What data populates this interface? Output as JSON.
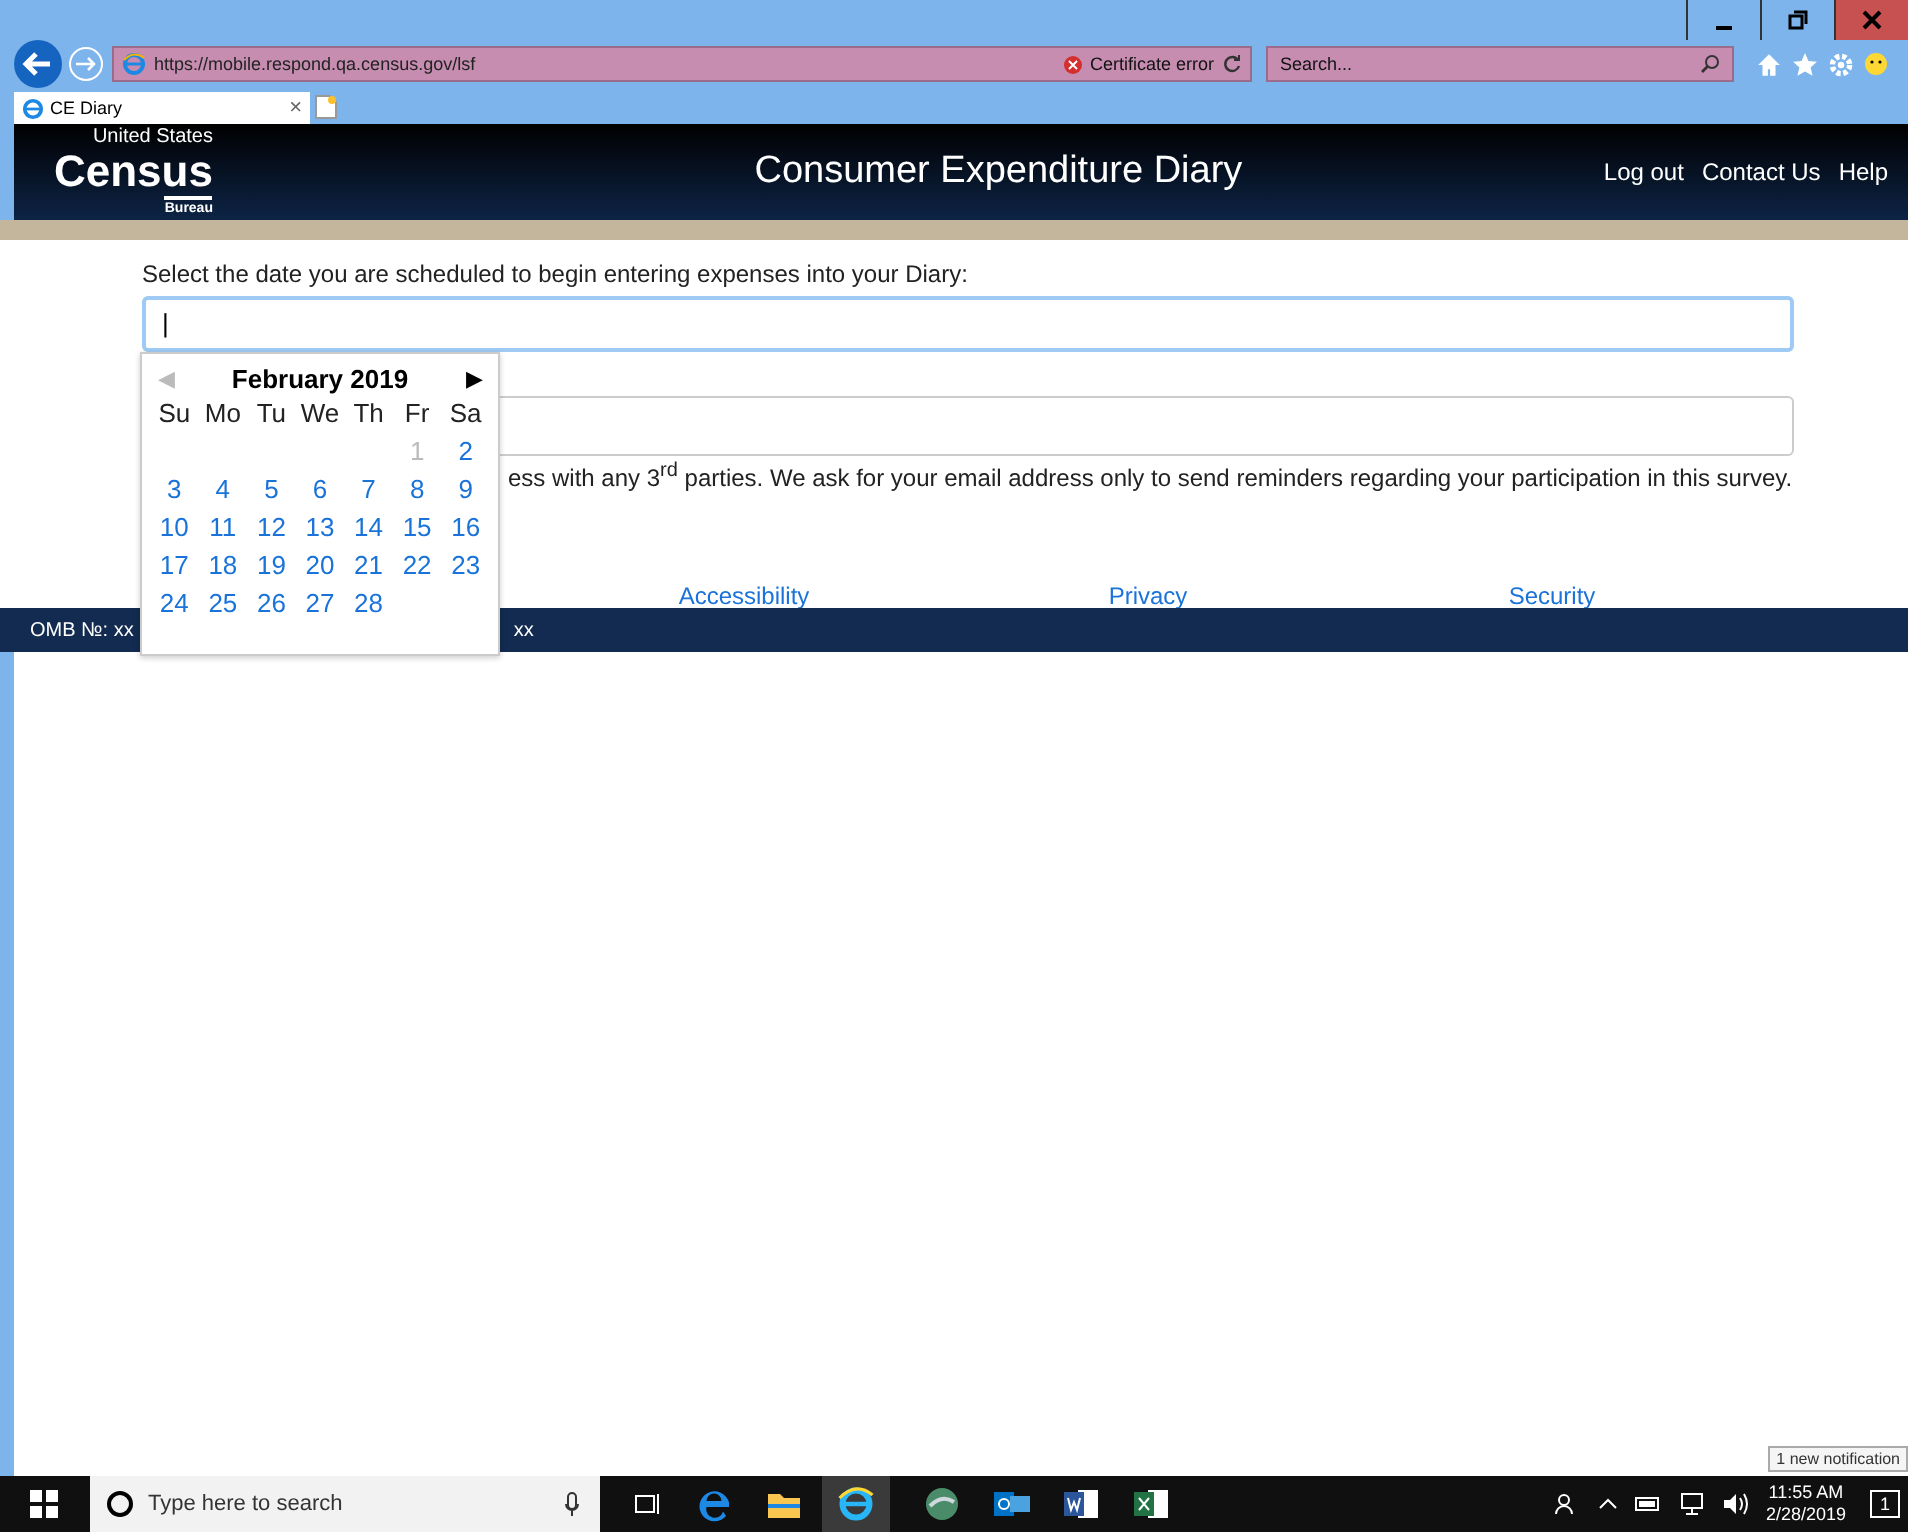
{
  "browser": {
    "url": "https://mobile.respond.qa.census.gov/lsf",
    "certificate": "Certificate error",
    "search_placeholder": "Search...",
    "tabs": [
      {
        "label": "CE Diary",
        "close": "×",
        "selected": true
      }
    ]
  },
  "header": {
    "logo_top": "United States",
    "logo_main": "Census",
    "logo_sub": "Bureau",
    "title": "Consumer Expenditure Diary",
    "links": [
      "Log out",
      "Contact Us",
      "Help"
    ]
  },
  "form": {
    "date_label": "Select the date you are scheduled to begin entering expenses into your Diary:",
    "date_value": "|",
    "notice": "ess with any 3$^{rd}$ parties. We ask for your email address only to send reminders regarding your participation in this survey."
  },
  "calendar": {
    "month": "February 2019",
    "prev": "◀",
    "next": "▶",
    "prev_disabled": true,
    "weekdays": [
      "Su",
      "Mo",
      "Tu",
      "We",
      "Th",
      "Fr",
      "Sa"
    ],
    "weeks": [
      {
        "days": [
          {
            "label": "1",
            "disabled": true
          },
          {
            "label": "2",
            "disabled": false
          }
        ]
      },
      {
        "days": [
          {
            "label": "3",
            "disabled": false
          },
          {
            "label": "4",
            "disabled": false
          },
          {
            "label": "5",
            "disabled": false
          },
          {
            "label": "6",
            "disabled": false
          },
          {
            "label": "7",
            "disabled": false
          },
          {
            "label": "8",
            "disabled": false
          },
          {
            "label": "9",
            "disabled": false
          }
        ]
      },
      {
        "days": [
          {
            "label": "10",
            "disabled": false
          },
          {
            "label": "11",
            "disabled": false
          },
          {
            "label": "12",
            "disabled": false
          },
          {
            "label": "13",
            "disabled": false
          },
          {
            "label": "14",
            "disabled": false
          },
          {
            "label": "15",
            "disabled": false
          },
          {
            "label": "16",
            "disabled": false
          }
        ]
      },
      {
        "days": [
          {
            "label": "17",
            "disabled": false
          },
          {
            "label": "18",
            "disabled": false
          },
          {
            "label": "19",
            "disabled": false
          },
          {
            "label": "20",
            "disabled": false
          },
          {
            "label": "21",
            "disabled": false
          },
          {
            "label": "22",
            "disabled": false
          },
          {
            "label": "23",
            "disabled": false
          }
        ]
      },
      {
        "days": [
          {
            "label": "24",
            "disabled": false
          },
          {
            "label": "25",
            "disabled": false
          },
          {
            "label": "26",
            "disabled": false
          },
          {
            "label": "27",
            "disabled": false
          },
          {
            "label": "28",
            "disabled": false
          }
        ]
      }
    ]
  },
  "footer": {
    "links": [
      "Accessibility",
      "Privacy",
      "Security"
    ],
    "omb_left": "OMB №: xx",
    "omb_right": "xx"
  },
  "taskbar": {
    "search_placeholder": "Type here to search",
    "time": "11:55 AM",
    "date": "2/28/2019",
    "notification_tooltip": "1 new notification",
    "notification_count": "1"
  }
}
